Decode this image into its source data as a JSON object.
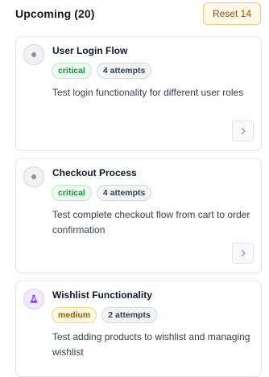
{
  "header": {
    "title": "Upcoming (20)",
    "reset_label": "Reset 14"
  },
  "colors": {
    "accent_warning": "#9a4b0c",
    "critical": "#1f8a3d",
    "medium": "#9a5a06"
  },
  "tests": [
    {
      "title": "User Login Flow",
      "priority": "critical",
      "attempts": "4 attempts",
      "description": "Test login functionality for different user roles",
      "status_icon": "pending-icon"
    },
    {
      "title": "Checkout Process",
      "priority": "critical",
      "attempts": "4 attempts",
      "description": "Test complete checkout flow from cart to order confirmation",
      "status_icon": "pending-icon"
    },
    {
      "title": "Wishlist Functionality",
      "priority": "medium",
      "attempts": "2 attempts",
      "description": "Test adding products to wishlist and managing wishlist",
      "status_icon": "flask-icon"
    }
  ]
}
